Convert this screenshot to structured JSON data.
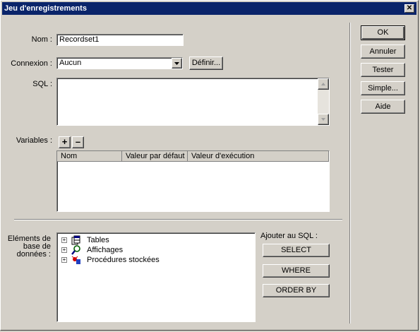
{
  "window": {
    "title": "Jeu d'enregistrements",
    "close_glyph": "✕"
  },
  "form": {
    "name_label": "Nom :",
    "name_value": "Recordset1",
    "connection_label": "Connexion :",
    "connection_value": "Aucun",
    "define_button": "Définir...",
    "sql_label": "SQL :",
    "variables_label": "Variables :",
    "add_glyph": "+",
    "remove_glyph": "–"
  },
  "variables_table": {
    "columns": [
      "Nom",
      "Valeur par défaut",
      "Valeur d'exécution"
    ]
  },
  "db_items": {
    "label": "Eléments de base de données :",
    "tree": [
      {
        "label": "Tables",
        "icon": "tables-icon",
        "expand": "+"
      },
      {
        "label": "Affichages",
        "icon": "views-icon",
        "expand": "+"
      },
      {
        "label": "Procédures stockées",
        "icon": "stored-procedures-icon",
        "expand": "+"
      }
    ]
  },
  "add_to_sql": {
    "label": "Ajouter au SQL :",
    "buttons": [
      "SELECT",
      "WHERE",
      "ORDER BY"
    ]
  },
  "side_buttons": [
    "OK",
    "Annuler",
    "Tester",
    "Simple...",
    "Aide"
  ]
}
